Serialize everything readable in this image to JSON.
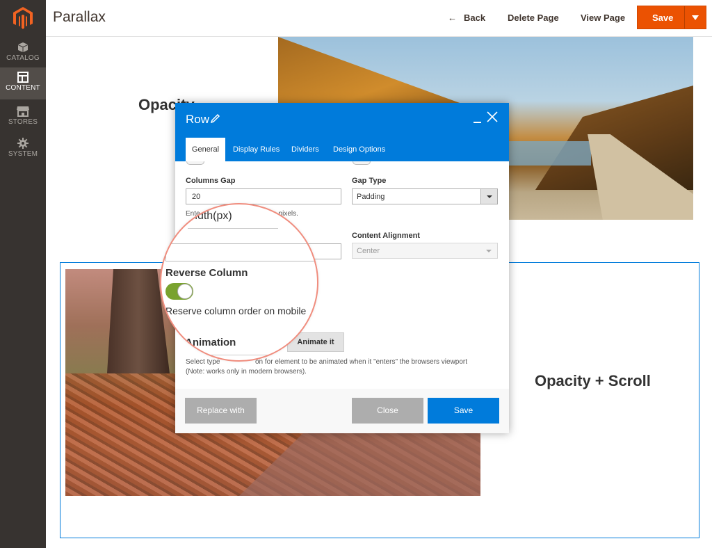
{
  "header": {
    "title": "Parallax",
    "back_label": "Back",
    "delete_label": "Delete Page",
    "view_label": "View Page",
    "save_label": "Save"
  },
  "sidebar": {
    "items": [
      {
        "label": "CATALOG",
        "icon": "box-icon"
      },
      {
        "label": "CONTENT",
        "icon": "layout-icon",
        "active": true
      },
      {
        "label": "STORES",
        "icon": "store-icon"
      },
      {
        "label": "SYSTEM",
        "icon": "gear-icon"
      }
    ]
  },
  "canvas": {
    "heading_left": "Opacity",
    "heading_right": "Opacity + Scroll"
  },
  "modal": {
    "title": "Row",
    "tabs": [
      "General",
      "Display Rules",
      "Dividers",
      "Design Options"
    ],
    "columns_gap_label": "Columns Gap",
    "columns_gap_value": "20",
    "columns_gap_note_start": "Ente",
    "columns_gap_note_end": "in pixels.",
    "gap_type_label": "Gap Type",
    "gap_type_value": "Padding",
    "content_alignment_label": "Content Alignment",
    "content_alignment_value": "Center",
    "animate_button": "Animate it",
    "animation_note_start": "Select type",
    "animation_note_end": "on for element to be animated when it \"enters\" the browsers viewport",
    "animation_note_line2": "(Note: works only in modern browsers).",
    "replace_button": "Replace with",
    "close_button": "Close",
    "save_button": "Save"
  },
  "magnifier": {
    "width_label": "Vidth(px)",
    "reverse_heading": "Reverse Column",
    "reverse_on": true,
    "reverse_desc": "Reserve column order on mobile",
    "animation_label": "Animation"
  },
  "colors": {
    "accent": "#eb5202",
    "primary": "#007bdb",
    "sidebar": "#373330",
    "toggle_on": "#79a22e",
    "magnifier_ring": "#f08d7e"
  }
}
